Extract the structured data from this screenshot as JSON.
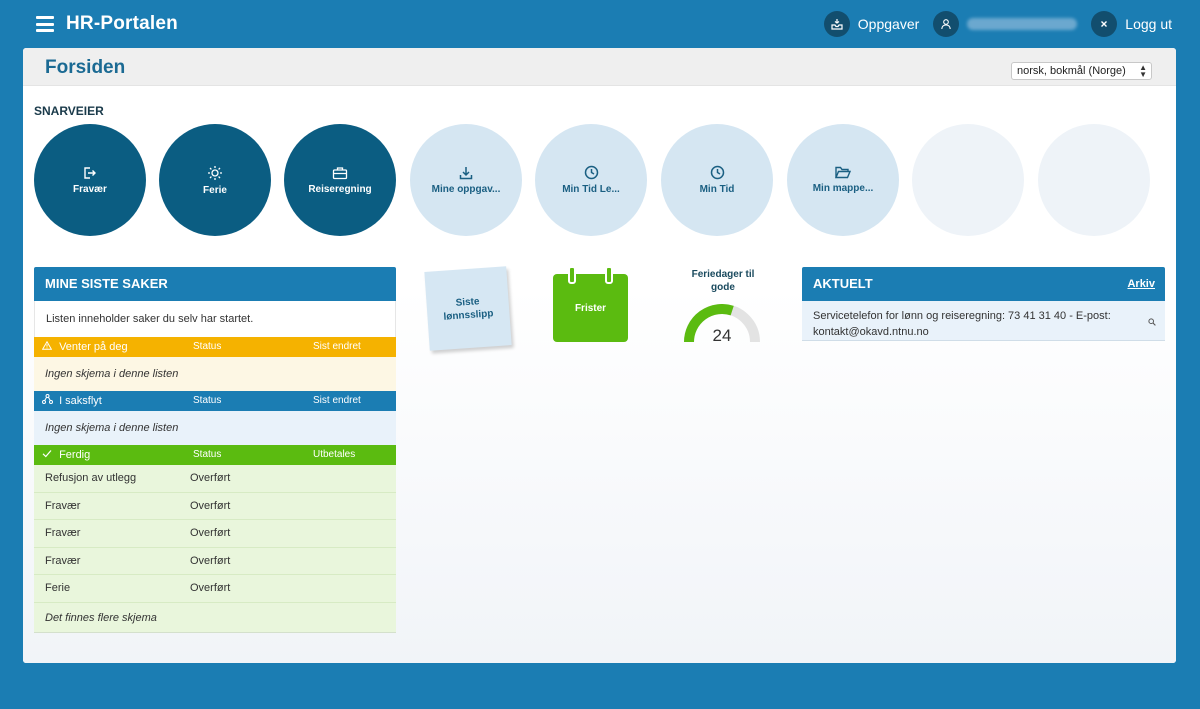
{
  "app": {
    "title": "HR-Portalen"
  },
  "topbar": {
    "tasks_label": "Oppgaver",
    "user_name": "",
    "logout_label": "Logg ut"
  },
  "page": {
    "title": "Forsiden",
    "language": "norsk, bokmål (Norge)"
  },
  "shortcuts": {
    "title": "SNARVEIER",
    "items": [
      {
        "label": "Fravær",
        "icon": "exit-icon",
        "style": "dark"
      },
      {
        "label": "Ferie",
        "icon": "sun-icon",
        "style": "dark"
      },
      {
        "label": "Reiseregning",
        "icon": "briefcase-icon",
        "style": "dark"
      },
      {
        "label": "Mine oppgav...",
        "icon": "download-icon",
        "style": "light"
      },
      {
        "label": "Min Tid Le...",
        "icon": "clock-icon",
        "style": "light"
      },
      {
        "label": "Min Tid",
        "icon": "clock-icon",
        "style": "light"
      },
      {
        "label": "Min mappe...",
        "icon": "folder-open-icon",
        "style": "light"
      },
      {
        "label": "",
        "style": "empty"
      },
      {
        "label": "",
        "style": "empty"
      }
    ]
  },
  "cases": {
    "title": "MINE SISTE SAKER",
    "description": "Listen inneholder saker du selv har startet.",
    "waiting": {
      "label": "Venter på deg",
      "col_status": "Status",
      "col_date": "Sist endret",
      "empty": "Ingen skjema i denne listen"
    },
    "workflow": {
      "label": "I saksflyt",
      "col_status": "Status",
      "col_date": "Sist endret",
      "empty": "Ingen skjema i denne listen"
    },
    "done": {
      "label": "Ferdig",
      "col_status": "Status",
      "col_date": "Utbetales",
      "rows": [
        {
          "name": "Refusjon av utlegg",
          "status": "Overført"
        },
        {
          "name": "Fravær",
          "status": "Overført"
        },
        {
          "name": "Fravær",
          "status": "Overført"
        },
        {
          "name": "Fravær",
          "status": "Overført"
        },
        {
          "name": "Ferie",
          "status": "Overført"
        }
      ],
      "more": "Det finnes flere skjema"
    }
  },
  "widgets": {
    "payslip_label": "Siste lønnsslipp",
    "deadlines_label": "Frister",
    "vacation_label": "Feriedager til gode",
    "vacation_days": 24,
    "vacation_fraction": 0.6
  },
  "news": {
    "title": "AKTUELT",
    "archive_label": "Arkiv",
    "text": "Servicetelefon for lønn og reiseregning: 73 41 31 40 - E-post: kontakt@okavd.ntnu.no"
  },
  "colors": {
    "brand_blue": "#1b7db3",
    "dark_circle": "#0b5d82",
    "warning": "#f5b200",
    "success": "#5bbb10"
  }
}
